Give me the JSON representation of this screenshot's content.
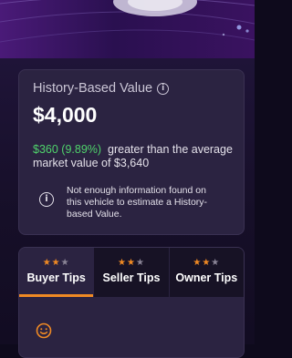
{
  "value_card": {
    "title": "History-Based Value",
    "value": "$4,000",
    "diff": "$360 (9.89%)",
    "compare_text": "greater than the average market value of $3,640",
    "note": "Not enough information found on this vehicle to estimate a History-based Value.",
    "info_icon": "info-icon"
  },
  "tips": {
    "tabs": [
      {
        "label": "Buyer Tips",
        "rating": 2,
        "max": 3,
        "active": true
      },
      {
        "label": "Seller Tips",
        "rating": 2,
        "max": 3,
        "active": false
      },
      {
        "label": "Owner Tips",
        "rating": 2,
        "max": 3,
        "active": false
      }
    ],
    "content_icon": "smile-icon"
  },
  "colors": {
    "accent": "#f08a24",
    "positive": "#4fd36b",
    "card": "#2b2341",
    "background": "#0e0a1c"
  }
}
